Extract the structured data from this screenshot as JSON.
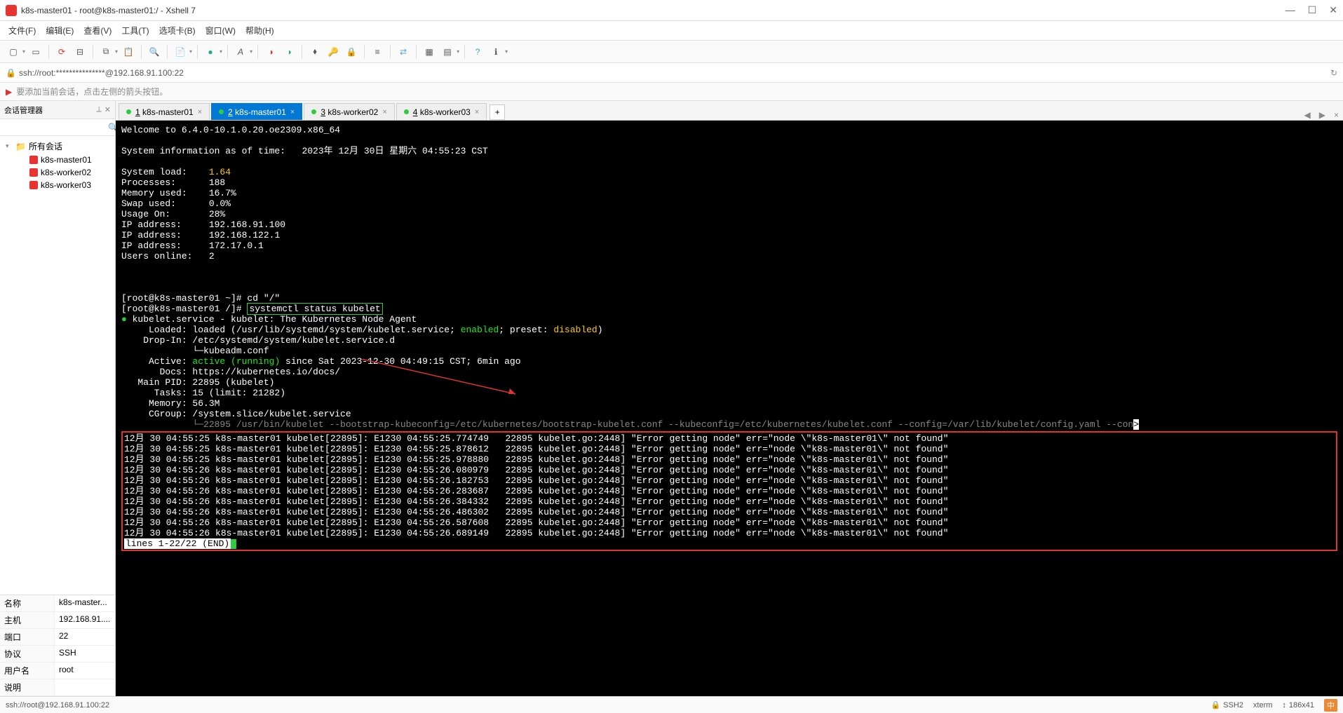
{
  "window": {
    "title": "k8s-master01 - root@k8s-master01:/ - Xshell 7",
    "min": "—",
    "max": "☐",
    "close": "✕"
  },
  "menu": [
    "文件(F)",
    "编辑(E)",
    "查看(V)",
    "工具(T)",
    "选项卡(B)",
    "窗口(W)",
    "帮助(H)"
  ],
  "address": {
    "text": "ssh://root:***************@192.168.91.100:22",
    "lock": "🔒"
  },
  "hint": {
    "flag": "▶",
    "text": "要添加当前会话，点击左侧的箭头按钮。"
  },
  "sidebar": {
    "title": "会话管理器",
    "pin": "⟂",
    "close": "✕",
    "search_placeholder": "",
    "root": "所有会话",
    "sessions": [
      "k8s-master01",
      "k8s-worker02",
      "k8s-worker03"
    ]
  },
  "props": [
    {
      "k": "名称",
      "v": "k8s-master..."
    },
    {
      "k": "主机",
      "v": "192.168.91...."
    },
    {
      "k": "端口",
      "v": "22"
    },
    {
      "k": "协议",
      "v": "SSH"
    },
    {
      "k": "用户名",
      "v": "root"
    },
    {
      "k": "说明",
      "v": ""
    }
  ],
  "tabs": [
    {
      "num": "1",
      "label": "k8s-master01",
      "active": false
    },
    {
      "num": "2",
      "label": "k8s-master01",
      "active": true
    },
    {
      "num": "3",
      "label": "k8s-worker02",
      "active": false
    },
    {
      "num": "4",
      "label": "k8s-worker03",
      "active": false
    }
  ],
  "terminal": {
    "welcome": "Welcome to 6.4.0-10.1.0.20.oe2309.x86_64",
    "sysinfo_time": "System information as of time:   2023年 12月 30日 星期六 04:55:23 CST",
    "stats": [
      {
        "k": "System load:",
        "v": "1.64",
        "yellow": true
      },
      {
        "k": "Processes:",
        "v": "188"
      },
      {
        "k": "Memory used:",
        "v": "16.7%"
      },
      {
        "k": "Swap used:",
        "v": "0.0%"
      },
      {
        "k": "Usage On:",
        "v": "28%"
      },
      {
        "k": "IP address:",
        "v": "192.168.91.100"
      },
      {
        "k": "IP address:",
        "v": "192.168.122.1"
      },
      {
        "k": "IP address:",
        "v": "172.17.0.1"
      },
      {
        "k": "Users online:",
        "v": "2"
      }
    ],
    "prompt1": "[root@k8s-master01 ~]# cd \"/\"",
    "prompt2_pre": "[root@k8s-master01 /]# ",
    "prompt2_cmd": "systemctl status kubelet",
    "svc_title": " kubelet.service - kubelet: The Kubernetes Node Agent",
    "loaded_pre": "     Loaded: loaded (/usr/lib/systemd/system/kubelet.service; ",
    "loaded_enabled": "enabled",
    "loaded_mid": "; preset: ",
    "loaded_disabled": "disabled",
    "loaded_post": ")",
    "dropin": "    Drop-In: /etc/systemd/system/kubelet.service.d",
    "dropin2": "             └─kubeadm.conf",
    "active_pre": "     Active: ",
    "active_val": "active (running)",
    "active_post": " since Sat 2023-12-30 04:49:15 CST; 6min ago",
    "docs": "       Docs: https://kubernetes.io/docs/",
    "mainpid": "   Main PID: 22895 (kubelet)",
    "tasks": "      Tasks: 15 (limit: 21282)",
    "memory": "     Memory: 56.3M",
    "cgroup": "     CGroup: /system.slice/kubelet.service",
    "cgroup2": "             └─22895 /usr/bin/kubelet --bootstrap-kubeconfig=/etc/kubernetes/bootstrap-kubelet.conf --kubeconfig=/etc/kubernetes/kubelet.conf --config=/var/lib/kubelet/config.yaml --con",
    "logs": [
      "12月 30 04:55:25 k8s-master01 kubelet[22895]: E1230 04:55:25.774749   22895 kubelet.go:2448] \"Error getting node\" err=\"node \\\"k8s-master01\\\" not found\"",
      "12月 30 04:55:25 k8s-master01 kubelet[22895]: E1230 04:55:25.878612   22895 kubelet.go:2448] \"Error getting node\" err=\"node \\\"k8s-master01\\\" not found\"",
      "12月 30 04:55:25 k8s-master01 kubelet[22895]: E1230 04:55:25.978880   22895 kubelet.go:2448] \"Error getting node\" err=\"node \\\"k8s-master01\\\" not found\"",
      "12月 30 04:55:26 k8s-master01 kubelet[22895]: E1230 04:55:26.080979   22895 kubelet.go:2448] \"Error getting node\" err=\"node \\\"k8s-master01\\\" not found\"",
      "12月 30 04:55:26 k8s-master01 kubelet[22895]: E1230 04:55:26.182753   22895 kubelet.go:2448] \"Error getting node\" err=\"node \\\"k8s-master01\\\" not found\"",
      "12月 30 04:55:26 k8s-master01 kubelet[22895]: E1230 04:55:26.283687   22895 kubelet.go:2448] \"Error getting node\" err=\"node \\\"k8s-master01\\\" not found\"",
      "12月 30 04:55:26 k8s-master01 kubelet[22895]: E1230 04:55:26.384332   22895 kubelet.go:2448] \"Error getting node\" err=\"node \\\"k8s-master01\\\" not found\"",
      "12月 30 04:55:26 k8s-master01 kubelet[22895]: E1230 04:55:26.486302   22895 kubelet.go:2448] \"Error getting node\" err=\"node \\\"k8s-master01\\\" not found\"",
      "12月 30 04:55:26 k8s-master01 kubelet[22895]: E1230 04:55:26.587608   22895 kubelet.go:2448] \"Error getting node\" err=\"node \\\"k8s-master01\\\" not found\"",
      "12月 30 04:55:26 k8s-master01 kubelet[22895]: E1230 04:55:26.689149   22895 kubelet.go:2448] \"Error getting node\" err=\"node \\\"k8s-master01\\\" not found\""
    ],
    "pager": "lines 1-22/22 (END)"
  },
  "status": {
    "left": "ssh://root@192.168.91.100:22",
    "ssh": "SSH2",
    "term": "xterm",
    "size": "186x41",
    "caps": "中"
  }
}
